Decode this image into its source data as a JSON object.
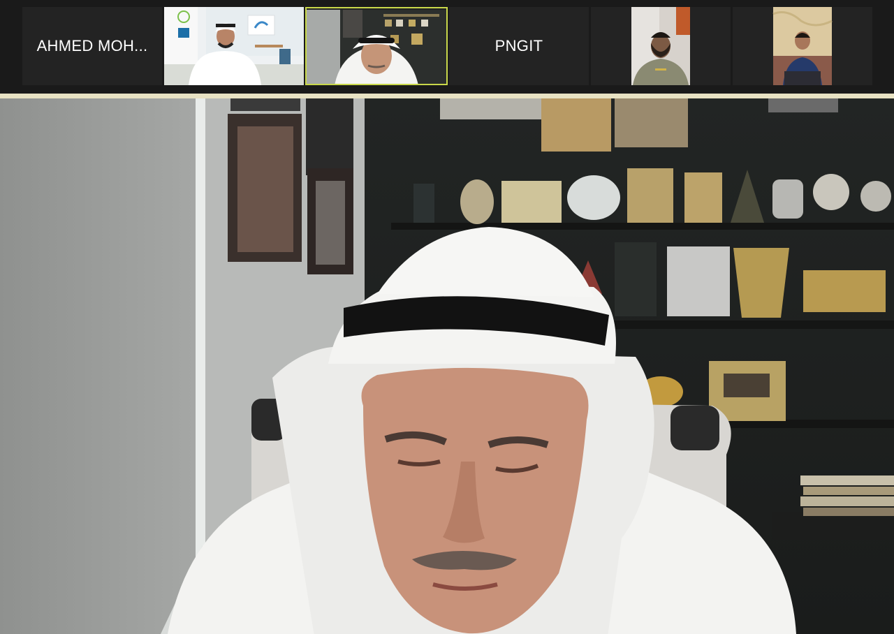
{
  "meeting": {
    "participants": [
      {
        "display_name": "AHMED MOH...",
        "video": false
      },
      {
        "display_name": "",
        "video": true
      },
      {
        "display_name": "",
        "video": true,
        "active_speaker": true
      },
      {
        "display_name": "PNGIT",
        "video": false
      },
      {
        "display_name": "",
        "video": true
      },
      {
        "display_name": "",
        "video": true
      }
    ],
    "active_speaker_color": "#c9d84a"
  }
}
